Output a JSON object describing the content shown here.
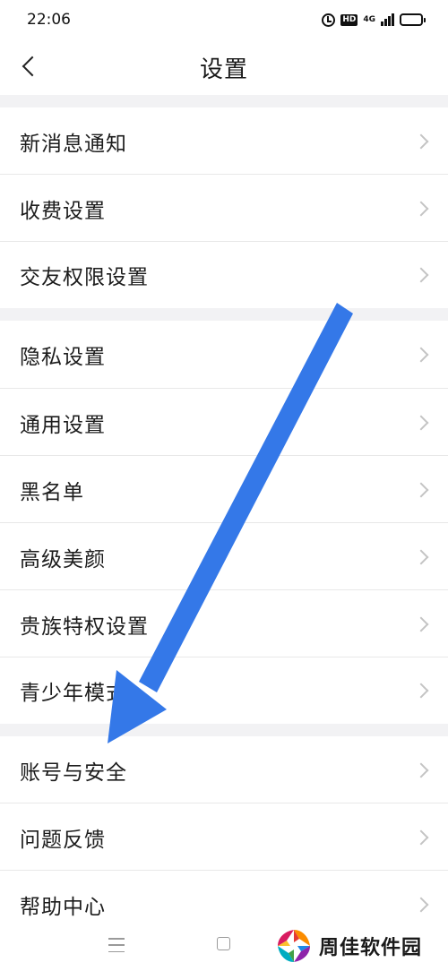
{
  "status_bar": {
    "time": "22:06",
    "hd_badge": "HD",
    "network": "4G",
    "icons": [
      "alarm-icon",
      "hd-icon",
      "network-4g-icon",
      "signal-icon",
      "battery-icon"
    ],
    "battery_level": 0.45
  },
  "header": {
    "title": "设置",
    "back_icon": "chevron-left-icon"
  },
  "sections": [
    {
      "items": [
        {
          "label": "新消息通知",
          "icon": "chevron-right-icon"
        },
        {
          "label": "收费设置",
          "icon": "chevron-right-icon"
        },
        {
          "label": "交友权限设置",
          "icon": "chevron-right-icon"
        }
      ]
    },
    {
      "items": [
        {
          "label": "隐私设置",
          "icon": "chevron-right-icon"
        },
        {
          "label": "通用设置",
          "icon": "chevron-right-icon"
        },
        {
          "label": "黑名单",
          "icon": "chevron-right-icon"
        },
        {
          "label": "高级美颜",
          "icon": "chevron-right-icon"
        },
        {
          "label": "贵族特权设置",
          "icon": "chevron-right-icon"
        },
        {
          "label": "青少年模式",
          "icon": "chevron-right-icon"
        }
      ]
    },
    {
      "items": [
        {
          "label": "账号与安全",
          "icon": "chevron-right-icon"
        },
        {
          "label": "问题反馈",
          "icon": "chevron-right-icon"
        },
        {
          "label": "帮助中心",
          "icon": "chevron-right-icon"
        }
      ]
    }
  ],
  "nav_bar": {
    "icons": [
      "menu-icon",
      "home-icon"
    ]
  },
  "watermark": {
    "text": "周佳软件园"
  },
  "annotation": {
    "color": "#3478e8",
    "icon": "arrow-pointer-icon"
  },
  "colors": {
    "background": "#ffffff",
    "section_gap": "#f2f2f4",
    "text": "#1c1c1c",
    "chevron": "#c4c4c4"
  }
}
